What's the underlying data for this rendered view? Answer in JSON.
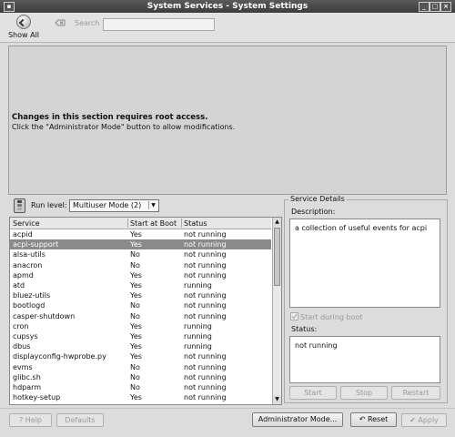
{
  "window": {
    "title": "System Services - System Settings"
  },
  "toolbar": {
    "show_all_label": "Show All",
    "search_label": "Search",
    "search_value": ""
  },
  "lock": {
    "title": "Changes in this section requires root access.",
    "message": "Click the \"Administrator Mode\" button to allow modifications."
  },
  "runlevel": {
    "label": "Run level:",
    "value": "Multiuser Mode (2)"
  },
  "table": {
    "headers": {
      "service": "Service",
      "start": "Start at Boot",
      "status": "Status"
    },
    "rows": [
      {
        "service": "acpid",
        "start": "Yes",
        "status": "not running"
      },
      {
        "service": "acpi-support",
        "start": "Yes",
        "status": "not running"
      },
      {
        "service": "alsa-utils",
        "start": "No",
        "status": "not running"
      },
      {
        "service": "anacron",
        "start": "No",
        "status": "not running"
      },
      {
        "service": "apmd",
        "start": "Yes",
        "status": "not running"
      },
      {
        "service": "atd",
        "start": "Yes",
        "status": "running"
      },
      {
        "service": "bluez-utils",
        "start": "Yes",
        "status": "not running"
      },
      {
        "service": "bootlogd",
        "start": "No",
        "status": "not running"
      },
      {
        "service": "casper-shutdown",
        "start": "No",
        "status": "not running"
      },
      {
        "service": "cron",
        "start": "Yes",
        "status": "running"
      },
      {
        "service": "cupsys",
        "start": "Yes",
        "status": "running"
      },
      {
        "service": "dbus",
        "start": "Yes",
        "status": "running"
      },
      {
        "service": "displayconfig-hwprobe.py",
        "start": "Yes",
        "status": "not running"
      },
      {
        "service": "evms",
        "start": "No",
        "status": "not running"
      },
      {
        "service": "glibc.sh",
        "start": "No",
        "status": "not running"
      },
      {
        "service": "hdparm",
        "start": "No",
        "status": "not running"
      },
      {
        "service": "hotkey-setup",
        "start": "Yes",
        "status": "not running"
      }
    ],
    "selected_index": 1
  },
  "details": {
    "legend": "Service Details",
    "description_label": "Description:",
    "description": "a collection of useful events for acpi",
    "start_during_boot_label": "Start during boot",
    "status_label": "Status:",
    "status": "not running",
    "buttons": {
      "start": "Start",
      "stop": "Stop",
      "restart": "Restart"
    }
  },
  "footer": {
    "help": "Help",
    "defaults": "Defaults",
    "admin_mode": "Administrator Mode...",
    "reset": "Reset",
    "apply": "Apply"
  }
}
